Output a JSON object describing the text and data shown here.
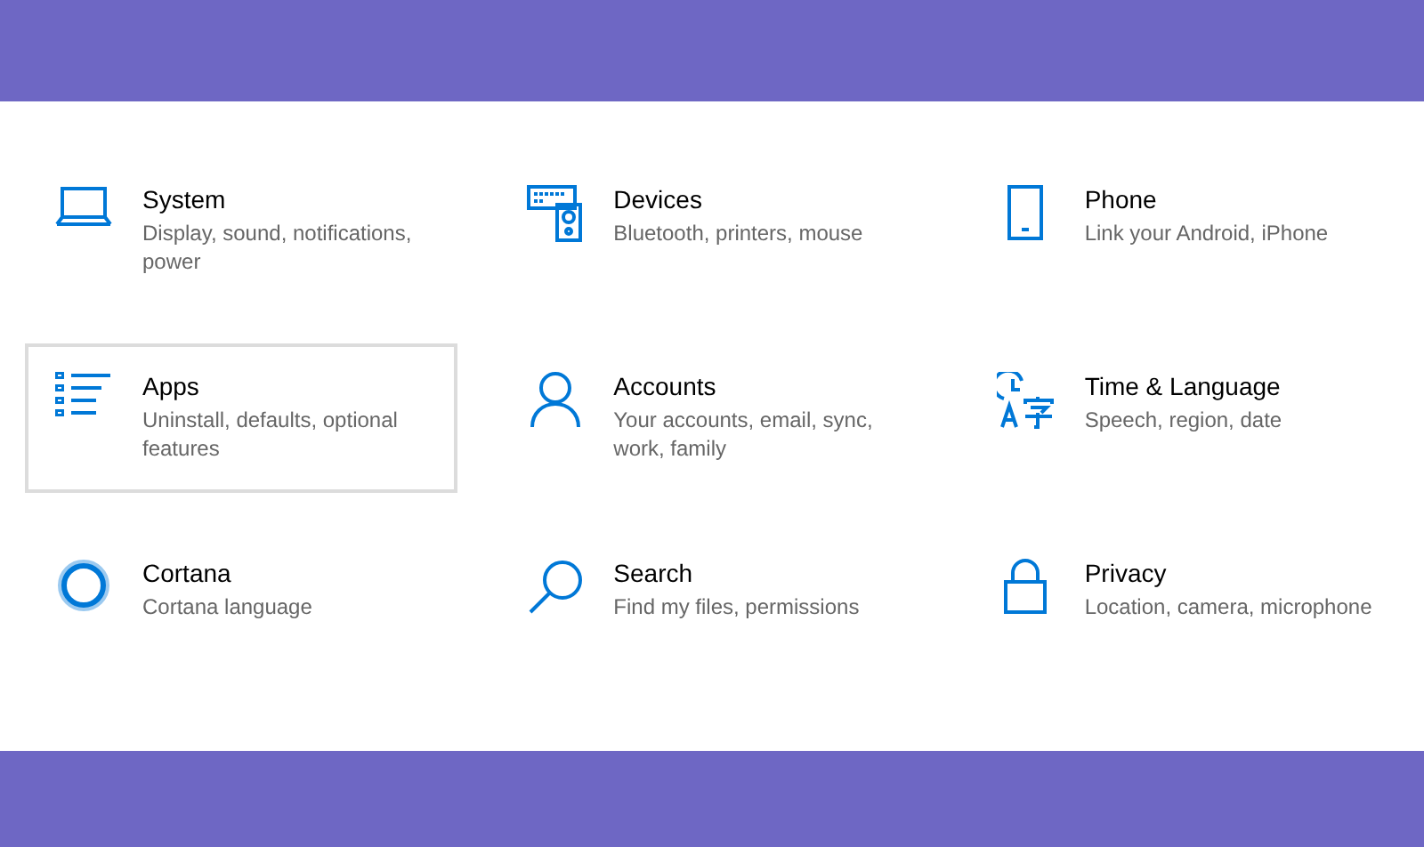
{
  "tiles": [
    {
      "title": "System",
      "description": "Display, sound, notifications, power",
      "selected": false
    },
    {
      "title": "Devices",
      "description": "Bluetooth, printers, mouse",
      "selected": false
    },
    {
      "title": "Phone",
      "description": "Link your Android, iPhone",
      "selected": false
    },
    {
      "title": "Apps",
      "description": "Uninstall, defaults, optional features",
      "selected": true
    },
    {
      "title": "Accounts",
      "description": "Your accounts, email, sync, work, family",
      "selected": false
    },
    {
      "title": "Time & Language",
      "description": "Speech, region, date",
      "selected": false
    },
    {
      "title": "Cortana",
      "description": "Cortana language",
      "selected": false
    },
    {
      "title": "Search",
      "description": "Find my files, permissions",
      "selected": false
    },
    {
      "title": "Privacy",
      "description": "Location, camera, microphone",
      "selected": false
    }
  ]
}
